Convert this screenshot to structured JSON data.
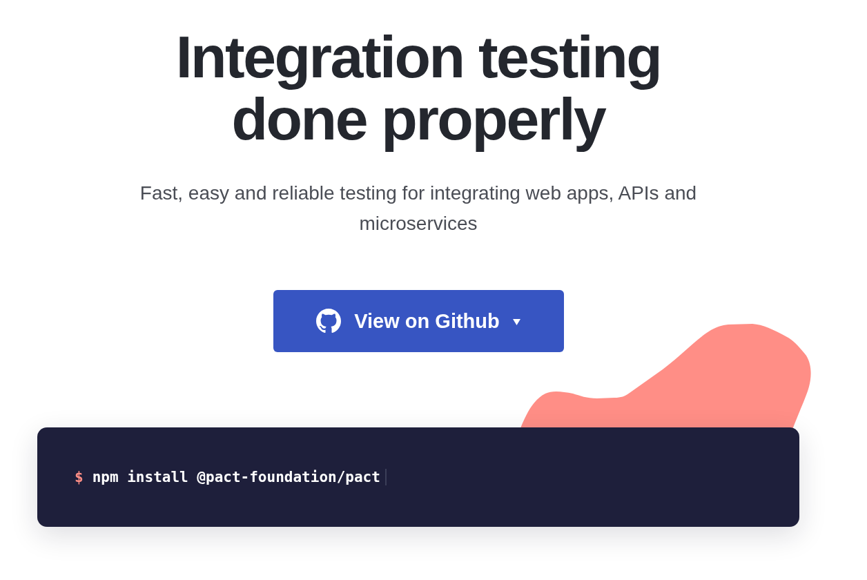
{
  "hero": {
    "title": "Integration testing done properly",
    "subtitle": "Fast, easy and reliable testing for integrating web apps, APIs and microservices"
  },
  "button": {
    "label": "View on Github"
  },
  "terminal": {
    "prompt": "$",
    "command": "npm install @pact-foundation/pact"
  }
}
